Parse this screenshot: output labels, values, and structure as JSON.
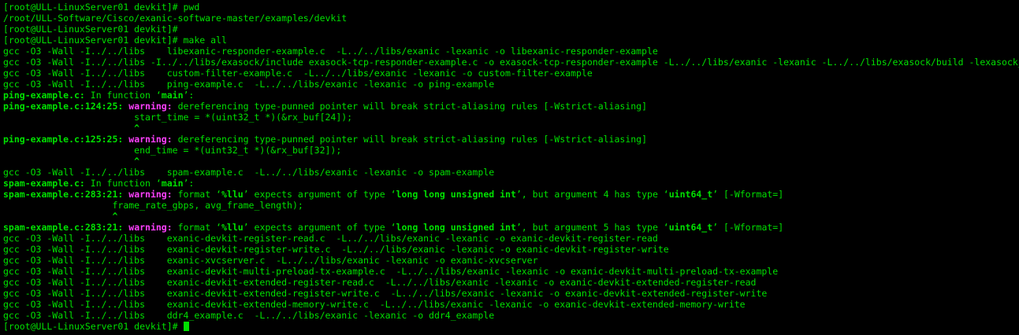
{
  "colors": {
    "background": "#000000",
    "text": "#00e000",
    "warning": "#ff40ff"
  },
  "terminal": {
    "lines": [
      [
        {
          "t": "[root@ULL-LinuxServer01 devkit]# pwd"
        }
      ],
      [
        {
          "t": "/root/ULL-Software/Cisco/exanic-software-master/examples/devkit"
        }
      ],
      [
        {
          "t": "[root@ULL-LinuxServer01 devkit]# "
        }
      ],
      [
        {
          "t": "[root@ULL-LinuxServer01 devkit]# make all"
        }
      ],
      [
        {
          "t": "gcc -O3 -Wall -I../../libs    libexanic-responder-example.c  -L../../libs/exanic -lexanic -o libexanic-responder-example"
        }
      ],
      [
        {
          "t": "gcc -O3 -Wall -I../../libs -I../../libs/exasock/include exasock-tcp-responder-example.c -o exasock-tcp-responder-example -L../../libs/exanic -lexanic -L../../libs/exasock/build -lexasock_ext"
        }
      ],
      [
        {
          "t": "gcc -O3 -Wall -I../../libs    custom-filter-example.c  -L../../libs/exanic -lexanic -o custom-filter-example"
        }
      ],
      [
        {
          "t": "gcc -O3 -Wall -I../../libs    ping-example.c  -L../../libs/exanic -lexanic -o ping-example"
        }
      ],
      [
        {
          "t": "ping-example.c:",
          "s": "b"
        },
        {
          "t": " In function ‘"
        },
        {
          "t": "main",
          "s": "b"
        },
        {
          "t": "’:"
        }
      ],
      [
        {
          "t": "ping-example.c:124:25:",
          "s": "b"
        },
        {
          "t": " "
        },
        {
          "t": "warning:",
          "s": "warn"
        },
        {
          "t": " dereferencing type-punned pointer will break strict-aliasing rules [-Wstrict-aliasing]"
        }
      ],
      [
        {
          "t": "                        start_time = *(uint32_t *)(&rx_buf[24]);"
        }
      ],
      [
        {
          "t": "                        ^",
          "s": "b"
        }
      ],
      [
        {
          "t": "ping-example.c:125:25:",
          "s": "b"
        },
        {
          "t": " "
        },
        {
          "t": "warning:",
          "s": "warn"
        },
        {
          "t": " dereferencing type-punned pointer will break strict-aliasing rules [-Wstrict-aliasing]"
        }
      ],
      [
        {
          "t": "                        end_time = *(uint32_t *)(&rx_buf[32]);"
        }
      ],
      [
        {
          "t": "                        ^",
          "s": "b"
        }
      ],
      [
        {
          "t": "gcc -O3 -Wall -I../../libs    spam-example.c  -L../../libs/exanic -lexanic -o spam-example"
        }
      ],
      [
        {
          "t": "spam-example.c:",
          "s": "b"
        },
        {
          "t": " In function ‘"
        },
        {
          "t": "main",
          "s": "b"
        },
        {
          "t": "’:"
        }
      ],
      [
        {
          "t": "spam-example.c:283:21:",
          "s": "b"
        },
        {
          "t": " "
        },
        {
          "t": "warning:",
          "s": "warn"
        },
        {
          "t": " format ‘"
        },
        {
          "t": "%llu",
          "s": "b"
        },
        {
          "t": "’ expects argument of type ‘"
        },
        {
          "t": "long long unsigned int",
          "s": "b"
        },
        {
          "t": "’, but argument 4 has type ‘"
        },
        {
          "t": "uint64_t",
          "s": "b"
        },
        {
          "t": "’ [-Wformat=]"
        }
      ],
      [
        {
          "t": "                    frame_rate_gbps, avg_frame_length);"
        }
      ],
      [
        {
          "t": "                    ^",
          "s": "b"
        }
      ],
      [
        {
          "t": "spam-example.c:283:21:",
          "s": "b"
        },
        {
          "t": " "
        },
        {
          "t": "warning:",
          "s": "warn"
        },
        {
          "t": " format ‘"
        },
        {
          "t": "%llu",
          "s": "b"
        },
        {
          "t": "’ expects argument of type ‘"
        },
        {
          "t": "long long unsigned int",
          "s": "b"
        },
        {
          "t": "’, but argument 5 has type ‘"
        },
        {
          "t": "uint64_t",
          "s": "b"
        },
        {
          "t": "’ [-Wformat=]"
        }
      ],
      [
        {
          "t": "gcc -O3 -Wall -I../../libs    exanic-devkit-register-read.c  -L../../libs/exanic -lexanic -o exanic-devkit-register-read"
        }
      ],
      [
        {
          "t": "gcc -O3 -Wall -I../../libs    exanic-devkit-register-write.c  -L../../libs/exanic -lexanic -o exanic-devkit-register-write"
        }
      ],
      [
        {
          "t": "gcc -O3 -Wall -I../../libs    exanic-xvcserver.c  -L../../libs/exanic -lexanic -o exanic-xvcserver"
        }
      ],
      [
        {
          "t": "gcc -O3 -Wall -I../../libs    exanic-devkit-multi-preload-tx-example.c  -L../../libs/exanic -lexanic -o exanic-devkit-multi-preload-tx-example"
        }
      ],
      [
        {
          "t": "gcc -O3 -Wall -I../../libs    exanic-devkit-extended-register-read.c  -L../../libs/exanic -lexanic -o exanic-devkit-extended-register-read"
        }
      ],
      [
        {
          "t": "gcc -O3 -Wall -I../../libs    exanic-devkit-extended-register-write.c  -L../../libs/exanic -lexanic -o exanic-devkit-extended-register-write"
        }
      ],
      [
        {
          "t": "gcc -O3 -Wall -I../../libs    exanic-devkit-extended-memory-write.c  -L../../libs/exanic -lexanic -o exanic-devkit-extended-memory-write"
        }
      ],
      [
        {
          "t": "gcc -O3 -Wall -I../../libs    ddr4_example.c  -L../../libs/exanic -lexanic -o ddr4_example"
        }
      ],
      [
        {
          "t": "[root@ULL-LinuxServer01 devkit]# "
        }
      ]
    ]
  }
}
